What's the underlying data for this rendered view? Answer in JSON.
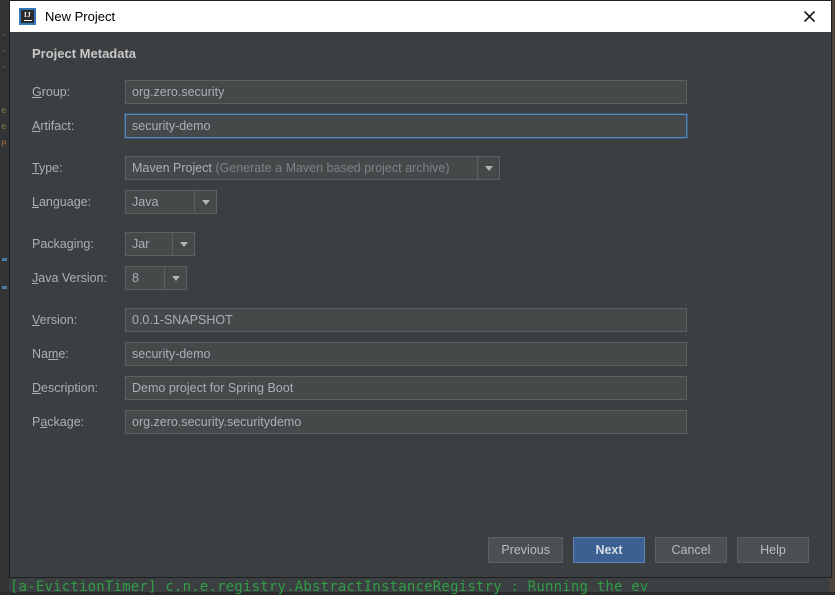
{
  "window": {
    "title": "New Project",
    "app_icon": "intellij-idea-icon",
    "icon_letters": "IJ",
    "close_icon": "close-icon"
  },
  "dialog": {
    "section_title": "Project Metadata",
    "fields": [
      {
        "key": "group",
        "label": "Group:",
        "mnemonic_index": 0,
        "kind": "text",
        "value": "org.zero.security",
        "focused": false
      },
      {
        "key": "artifact",
        "label": "Artifact:",
        "mnemonic_index": 0,
        "kind": "text",
        "value": "security-demo",
        "focused": true
      },
      {
        "key": "type",
        "label": "Type:",
        "mnemonic_index": 0,
        "kind": "combo",
        "value": "Maven Project",
        "value_hint": "(Generate a Maven based project archive)",
        "arrow_icon": "chevron-down-icon"
      },
      {
        "key": "language",
        "label": "Language:",
        "mnemonic_index": 0,
        "kind": "combo",
        "value": "Java",
        "value_hint": "",
        "arrow_icon": "chevron-down-icon"
      },
      {
        "key": "packaging",
        "label": "Packaging:",
        "mnemonic_index": 6,
        "kind": "combo",
        "value": "Jar",
        "value_hint": "",
        "arrow_icon": "chevron-down-icon"
      },
      {
        "key": "java_version",
        "label": "Java Version:",
        "mnemonic_index": 0,
        "kind": "combo",
        "value": "8",
        "value_hint": "",
        "arrow_icon": "chevron-down-icon"
      },
      {
        "key": "version",
        "label": "Version:",
        "mnemonic_index": 0,
        "kind": "text",
        "value": "0.0.1-SNAPSHOT",
        "focused": false
      },
      {
        "key": "name",
        "label": "Name:",
        "mnemonic_index": 2,
        "kind": "text",
        "value": "security-demo",
        "focused": false
      },
      {
        "key": "description",
        "label": "Description:",
        "mnemonic_index": 0,
        "kind": "text",
        "value": "Demo project for Spring Boot",
        "focused": false
      },
      {
        "key": "package",
        "label": "Package:",
        "mnemonic_index": 2,
        "kind": "text",
        "value": "org.zero.security.securitydemo",
        "focused": false
      }
    ],
    "buttons": [
      {
        "key": "previous",
        "label": "Previous",
        "default": false
      },
      {
        "key": "next",
        "label": "Next",
        "default": true
      },
      {
        "key": "cancel",
        "label": "Cancel",
        "default": false
      },
      {
        "key": "help",
        "label": "Help",
        "default": false
      }
    ]
  },
  "backdrop": {
    "console_line": "[a-EvictionTimer] c.n.e.registry.AbstractInstanceRegistry  : Running the ev"
  },
  "colors": {
    "dialog_bg": "#3c3f41",
    "field_bg": "#45494a",
    "field_border": "#5e6060",
    "focus_border": "#4a88c7",
    "label_text": "#a9b1b6",
    "default_button_bg": "#3c6091",
    "title_bar_bg": "#ffffff",
    "console_green": "#2f9e44"
  }
}
